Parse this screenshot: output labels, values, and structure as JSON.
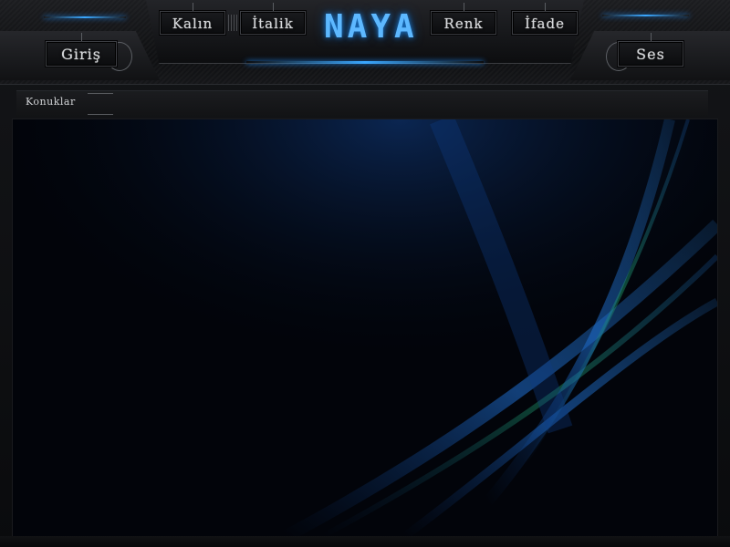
{
  "header": {
    "logo_text": "NAYA",
    "buttons": {
      "kalin": "Kalın",
      "italik": "İtalik",
      "renk": "Renk",
      "ifade": "İfade",
      "giris": "Giriş",
      "ses": "Ses"
    }
  },
  "status_bar": {
    "label": "Konuklar"
  },
  "theme": {
    "background": "#0b0c0e",
    "accent_blue": "#3aa7ff",
    "viewport_bg": "#02040a",
    "streak_blue": "#1f6fd1",
    "streak_green": "#1fa06a"
  },
  "icons": {
    "logo": "naya-logo",
    "grip": "grip-icon"
  }
}
